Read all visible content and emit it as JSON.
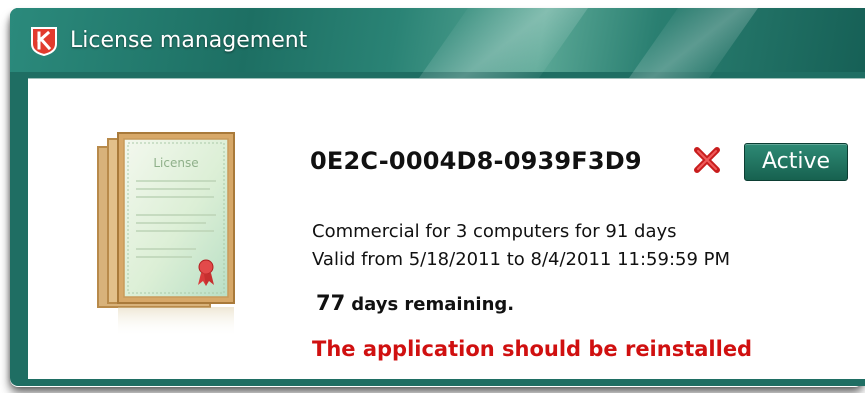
{
  "window": {
    "title": "License management",
    "app_icon": "kaspersky-k-icon"
  },
  "license": {
    "key": "0E2C-0004D8-0939F3D9",
    "remove_icon": "red-x-icon",
    "status": "Active",
    "certificate_label": "License",
    "type_line": "Commercial for 3 computers for 91 days",
    "validity_line": "Valid from 5/18/2011 to 8/4/2011 11:59:59 PM",
    "days_remaining": "77",
    "days_remaining_text": "days remaining.",
    "warning": "The application should be reinstalled"
  },
  "colors": {
    "titlebar": "#1f6e63",
    "status_badge": "#17614f",
    "warning": "#d01010"
  }
}
